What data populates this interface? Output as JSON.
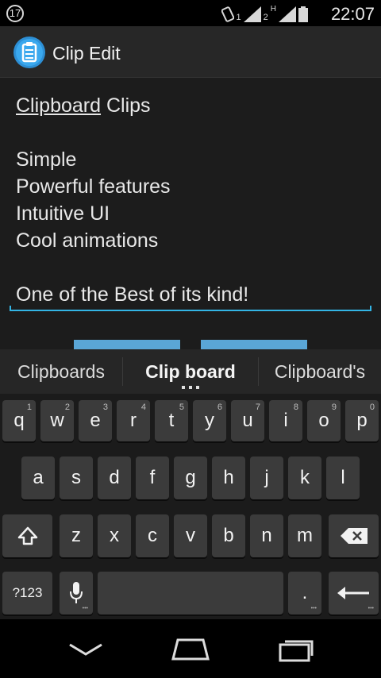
{
  "status_bar": {
    "notification_count": "17",
    "sim1_label": "1",
    "sim2_label": "2",
    "network_type": "H",
    "time": "22:07",
    "icons": [
      "vibrate-icon",
      "signal-icon",
      "signal-icon",
      "battery-icon"
    ]
  },
  "action_bar": {
    "title": "Clip Edit",
    "icon": "clipboard-icon"
  },
  "editor": {
    "lines": {
      "l1_underlined": "Clipboard",
      "l1_rest": " Clips",
      "l2": "Simple",
      "l3": "Powerful features",
      "l4": "Intuitive UI",
      "l5": "Cool animations",
      "l6": "One of the Best of its kind!"
    }
  },
  "suggestions": {
    "left": "Clipboards",
    "middle": "Clip board",
    "right": "Clipboard's"
  },
  "keyboard": {
    "row1": [
      {
        "label": "q",
        "hint": "1"
      },
      {
        "label": "w",
        "hint": "2"
      },
      {
        "label": "e",
        "hint": "3"
      },
      {
        "label": "r",
        "hint": "4"
      },
      {
        "label": "t",
        "hint": "5"
      },
      {
        "label": "y",
        "hint": "6"
      },
      {
        "label": "u",
        "hint": "7"
      },
      {
        "label": "i",
        "hint": "8"
      },
      {
        "label": "o",
        "hint": "9"
      },
      {
        "label": "p",
        "hint": "0"
      }
    ],
    "row2": [
      "a",
      "s",
      "d",
      "f",
      "g",
      "h",
      "j",
      "k",
      "l"
    ],
    "row3": [
      "z",
      "x",
      "c",
      "v",
      "b",
      "n",
      "m"
    ],
    "symbols_label": "?123",
    "period_label": ".",
    "icons": [
      "shift-icon",
      "backspace-icon",
      "microphone-icon",
      "enter-icon"
    ]
  },
  "navbar": {
    "icons": [
      "back-icon",
      "home-icon",
      "recents-icon"
    ]
  },
  "colors": {
    "accent": "#33b5e5",
    "key_bg": "#3b3b3b",
    "editor_bg": "#1c1c1c"
  }
}
